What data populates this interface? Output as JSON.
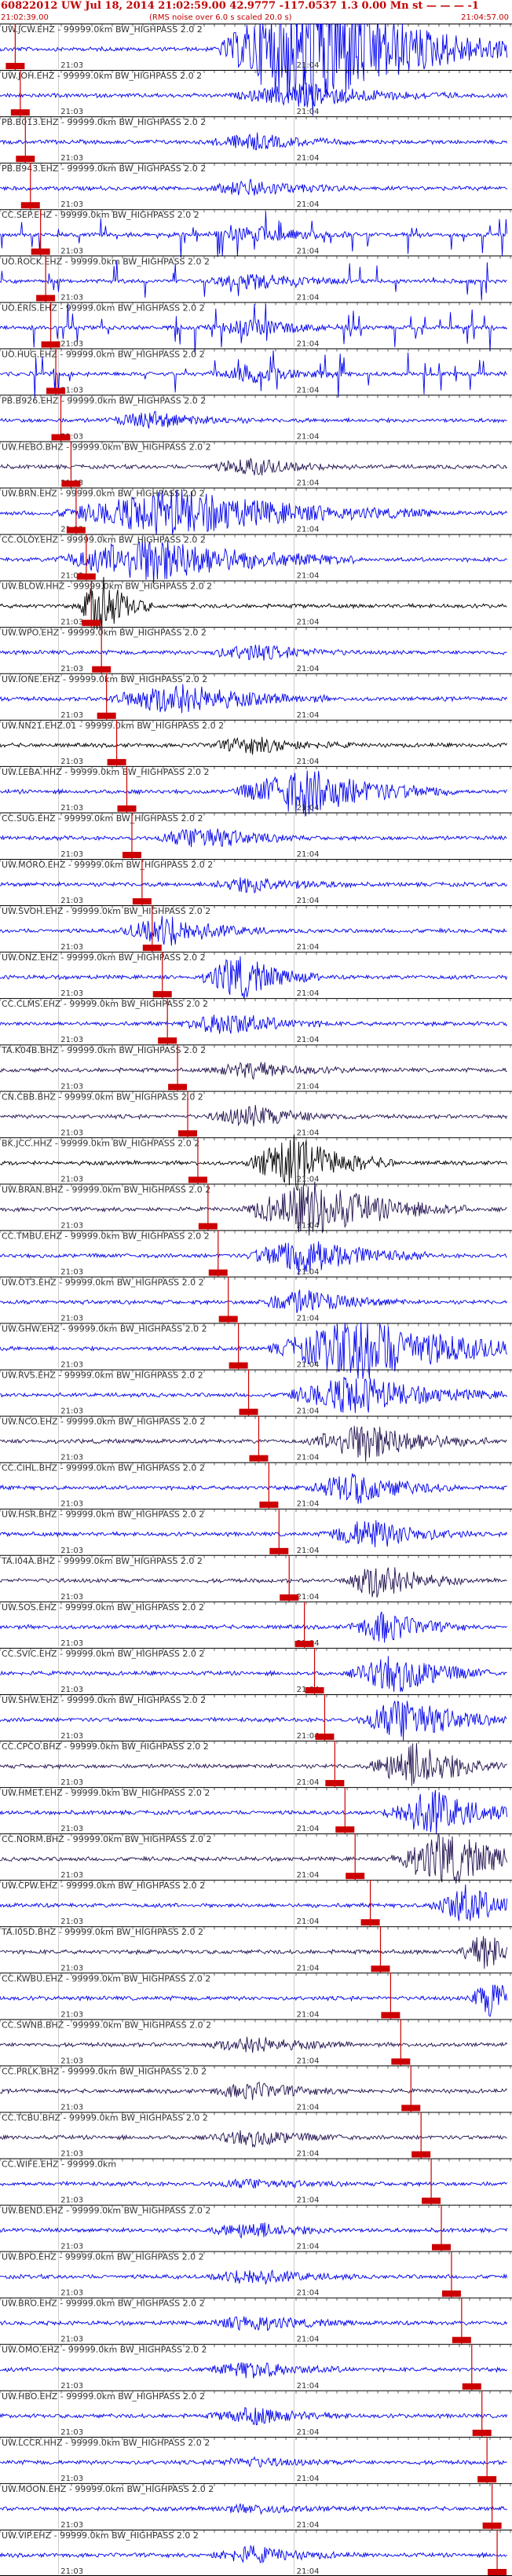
{
  "header": {
    "title": "60822012 UW Jul 18, 2014 21:02:59.00   42.9777 -117.0537  1.3 0.00 Mn st — — — -1",
    "left_time": "21:02:39.00",
    "note": "(RMS noise over 6.0 s scaled 20.0 s)",
    "right_time": "21:04:57.00"
  },
  "colors": {
    "trace_blue": "#0000ee",
    "trace_dark": "#22114f",
    "trace_black": "#000000",
    "pick": "#cc0000",
    "header": "#c00000"
  },
  "chart_data": {
    "type": "line",
    "title": "60822012 UW Jul 18, 2014 21:02:59.00   42.9777 -117.0537  1.3 0.00 Mn st — — — -1",
    "xlabel": "",
    "ylabel": "",
    "time_range": [
      "21:02:39.00",
      "21:04:57.00"
    ],
    "tick_labels": [
      "21:03",
      "21:04"
    ],
    "stations": [
      {
        "label": "UW.JCW.EHZ - 99999.0km BW_HIGHPASS  2.0  2",
        "color": "#0000ee",
        "burst": [
          0.62,
          0.2,
          9
        ],
        "pick": 0.03
      },
      {
        "label": "UW.JOH.EHZ - 99999.0km BW_HIGHPASS  2.0  2",
        "color": "#0000ee",
        "burst": [
          0.6,
          0.15,
          1.5
        ],
        "pick": 0.04
      },
      {
        "label": "PB.B013.EHZ - 99999.0km BW_HIGHPASS  2.0  2",
        "color": "#0000ee",
        "burst": [
          0.5,
          0.1,
          1
        ],
        "pick": 0.05
      },
      {
        "label": "PB.B943.EHZ - 99999.0km BW_HIGHPASS  2.0  2",
        "color": "#0000ee",
        "burst": [
          0.5,
          0.1,
          1
        ],
        "pick": 0.06
      },
      {
        "label": "CC.SEP.EHZ - 99999.0km BW_HIGHPASS  2.0  2",
        "color": "#0000ee",
        "spikes": true,
        "pick": 0.08
      },
      {
        "label": "UO.ROCK.EHZ - 99999.0km BW_HIGHPASS  2.0  2",
        "color": "#0000ee",
        "spikes": true,
        "pick": 0.09
      },
      {
        "label": "UO.ERIS.EHZ - 99999.0km BW_HIGHPASS  2.0  2",
        "color": "#0000ee",
        "spikes": true,
        "pick": 0.1
      },
      {
        "label": "UO.HUG.EHZ - 99999.0km BW_HIGHPASS  2.0  2",
        "color": "#0000ee",
        "spikes": true,
        "pick": 0.11
      },
      {
        "label": "PB.B926.EHZ - 99999.0km BW_HIGHPASS  2.0  2",
        "color": "#0000ee",
        "burst": [
          0.3,
          0.1,
          1
        ],
        "pick": 0.12
      },
      {
        "label": "UW.HEBO.BHZ - 99999.0km BW_HIGHPASS  2.0  2",
        "color": "#22114f",
        "burst": [
          0.5,
          0.1,
          1
        ],
        "pick": 0.14
      },
      {
        "label": "UW.BRN.EHZ - 99999.0km BW_HIGHPASS  2.0  2",
        "color": "#0000ee",
        "burst": [
          0.35,
          0.25,
          3
        ],
        "pick": 0.15
      },
      {
        "label": "CC.OLOY.EHZ - 99999.0km BW_HIGHPASS  2.0  2",
        "color": "#0000ee",
        "burst": [
          0.3,
          0.2,
          3
        ],
        "pick": 0.17
      },
      {
        "label": "UW.BLOW.HHZ - 99999.0km BW_HIGHPASS  2.0  2",
        "color": "#000000",
        "burst": [
          0.2,
          0.05,
          4
        ],
        "pick": 0.18
      },
      {
        "label": "UW.WPO.EHZ - 99999.0km BW_HIGHPASS  2.0  2",
        "color": "#0000ee",
        "burst": [
          0.5,
          0.1,
          1
        ],
        "pick": 0.2
      },
      {
        "label": "UW.IONE.EHZ - 99999.0km BW_HIGHPASS  2.0  2",
        "color": "#0000ee",
        "burst": [
          0.35,
          0.15,
          2
        ],
        "pick": 0.21
      },
      {
        "label": "UW.NN21.EHZ.01 - 99999.0km BW_HIGHPASS  2.0  2",
        "color": "#000000",
        "burst": [
          0.5,
          0.1,
          1
        ],
        "pick": 0.23
      },
      {
        "label": "UW.LEBA.HHZ - 99999.0km BW_HIGHPASS  2.0  2",
        "color": "#0000ee",
        "burst": [
          0.6,
          0.15,
          3
        ],
        "pick": 0.25
      },
      {
        "label": "CC.SUG.EHZ - 99999.0km BW_HIGHPASS  2.0  2",
        "color": "#0000ee",
        "burst": [
          0.4,
          0.1,
          1.5
        ],
        "pick": 0.26
      },
      {
        "label": "UW.MORO.EHZ - 99999.0km BW_HIGHPASS  2.0  2",
        "color": "#0000ee",
        "burst": [
          0.5,
          0.1,
          1
        ],
        "pick": 0.28
      },
      {
        "label": "UW.SVOH.EHZ - 99999.0km BW_HIGHPASS  2.0  2",
        "color": "#0000ee",
        "burst": [
          0.33,
          0.1,
          2
        ],
        "pick": 0.3
      },
      {
        "label": "UW.ONZ.EHZ - 99999.0km BW_HIGHPASS  2.0  2",
        "color": "#0000ee",
        "burst": [
          0.47,
          0.08,
          3
        ],
        "pick": 0.32
      },
      {
        "label": "CC.CLMS.EHZ - 99999.0km BW_HIGHPASS  2.0  2",
        "color": "#0000ee",
        "burst": [
          0.45,
          0.1,
          1.5
        ],
        "pick": 0.33
      },
      {
        "label": "TA.K04B.BHZ - 99999.0km BW_HIGHPASS  2.0  2",
        "color": "#22114f",
        "burst": [
          0.5,
          0.1,
          1
        ],
        "pick": 0.35
      },
      {
        "label": "CN.CBB.BHZ - 99999.0km BW_HIGHPASS  2.0  2",
        "color": "#22114f",
        "burst": [
          0.5,
          0.1,
          1.3
        ],
        "pick": 0.37
      },
      {
        "label": "BK.JCC.HHZ - 99999.0km BW_HIGHPASS  2.0  2",
        "color": "#000000",
        "burst": [
          0.58,
          0.1,
          3.5
        ],
        "pick": 0.39
      },
      {
        "label": "UW.BRAN.BHZ - 99999.0km BW_HIGHPASS  2.0  2",
        "color": "#22114f",
        "burst": [
          0.62,
          0.15,
          3.5
        ],
        "pick": 0.41
      },
      {
        "label": "CC.TMBU.EHZ - 99999.0km BW_HIGHPASS  2.0  2",
        "color": "#0000ee",
        "burst": [
          0.6,
          0.12,
          2.5
        ],
        "pick": 0.43
      },
      {
        "label": "UW.OT3.EHZ - 99999.0km BW_HIGHPASS  2.0  2",
        "color": "#0000ee",
        "burst": [
          0.6,
          0.1,
          1.5
        ],
        "pick": 0.45
      },
      {
        "label": "UW.GHW.EHZ - 99999.0km BW_HIGHPASS  2.0  2",
        "color": "#0000ee",
        "burst": [
          0.72,
          0.2,
          4
        ],
        "pick": 0.47
      },
      {
        "label": "UW.RVS.EHZ - 99999.0km BW_HIGHPASS  2.0  2",
        "color": "#0000ee",
        "burst": [
          0.7,
          0.15,
          2.5
        ],
        "pick": 0.49
      },
      {
        "label": "UW.NCO.EHZ - 99999.0km BW_HIGHPASS  2.0  2",
        "color": "#22114f",
        "burst": [
          0.72,
          0.12,
          2.5
        ],
        "pick": 0.51
      },
      {
        "label": "CC.CIHL.BHZ - 99999.0km BW_HIGHPASS  2.0  2",
        "color": "#0000ee",
        "burst": [
          0.7,
          0.1,
          2
        ],
        "pick": 0.53
      },
      {
        "label": "UW.HSR.BHZ - 99999.0km BW_HIGHPASS  2.0  2",
        "color": "#0000ee",
        "burst": [
          0.73,
          0.1,
          2
        ],
        "pick": 0.55
      },
      {
        "label": "TA.I04A.BHZ - 99999.0km BW_HIGHPASS  2.0  2",
        "color": "#22114f",
        "burst": [
          0.75,
          0.08,
          2.5
        ],
        "pick": 0.57
      },
      {
        "label": "UW.SOS.EHZ - 99999.0km BW_HIGHPASS  2.0  2",
        "color": "#0000ee",
        "burst": [
          0.76,
          0.08,
          2
        ],
        "pick": 0.6
      },
      {
        "label": "CC.SVIC.EHZ - 99999.0km BW_HIGHPASS  2.0  2",
        "color": "#0000ee",
        "burst": [
          0.78,
          0.1,
          2.5
        ],
        "pick": 0.62
      },
      {
        "label": "UW.SHW.EHZ - 99999.0km BW_HIGHPASS  2.0  2",
        "color": "#0000ee",
        "burst": [
          0.8,
          0.1,
          3
        ],
        "pick": 0.64
      },
      {
        "label": "CC.CPCO.BHZ - 99999.0km BW_HIGHPASS  2.0  2",
        "color": "#22114f",
        "burst": [
          0.82,
          0.1,
          3
        ],
        "pick": 0.66
      },
      {
        "label": "UW.HMET.EHZ - 99999.0km BW_HIGHPASS  2.0  2",
        "color": "#0000ee",
        "burst": [
          0.85,
          0.1,
          3
        ],
        "pick": 0.68
      },
      {
        "label": "CC.NORM.BHZ - 99999.0km BW_HIGHPASS  2.0  2",
        "color": "#22114f",
        "burst": [
          0.88,
          0.12,
          3.5
        ],
        "pick": 0.7
      },
      {
        "label": "UW.CPW.EHZ - 99999.0km BW_HIGHPASS  2.0  2",
        "color": "#0000ee",
        "burst": [
          0.92,
          0.08,
          2.5
        ],
        "pick": 0.73
      },
      {
        "label": "TA.I05D.BHZ - 99999.0km BW_HIGHPASS  2.0  2",
        "color": "#22114f",
        "burst": [
          0.96,
          0.06,
          2.5
        ],
        "pick": 0.75
      },
      {
        "label": "CC.KWBU.EHZ - 99999.0km BW_HIGHPASS  2.0  2",
        "color": "#0000ee",
        "burst": [
          0.97,
          0.05,
          2.5
        ],
        "pick": 0.77
      },
      {
        "label": "CC.SWNB.BHZ - 99999.0km BW_HIGHPASS  2.0  2",
        "color": "#22114f",
        "burst": [
          0.5,
          0.1,
          1
        ],
        "pick": 0.79
      },
      {
        "label": "CC.PRLK.BHZ - 99999.0km BW_HIGHPASS  2.0  2",
        "color": "#22114f",
        "burst": [
          0.5,
          0.1,
          1
        ],
        "pick": 0.81
      },
      {
        "label": "CC.TCBU.BHZ - 99999.0km BW_HIGHPASS  2.0  2",
        "color": "#22114f",
        "burst": [
          0.5,
          0.1,
          1
        ],
        "pick": 0.83
      },
      {
        "label": "CC.WIFE.EHZ - 99999.0km",
        "color": "#0000ee",
        "burst": [
          0.5,
          0.1,
          0.5
        ],
        "pick": 0.85
      },
      {
        "label": "UW.BEND.EHZ - 99999.0km BW_HIGHPASS  2.0  2",
        "color": "#0000ee",
        "burst": [
          0.5,
          0.1,
          1
        ],
        "pick": 0.87
      },
      {
        "label": "UW.BPO.EHZ - 99999.0km BW_HIGHPASS  2.0  2",
        "color": "#0000ee",
        "burst": [
          0.5,
          0.1,
          1
        ],
        "pick": 0.89
      },
      {
        "label": "UW.BRO.EHZ - 99999.0km BW_HIGHPASS  2.0  2",
        "color": "#0000ee",
        "burst": [
          0.5,
          0.1,
          1
        ],
        "pick": 0.91
      },
      {
        "label": "UW.OMO.EHZ - 99999.0km BW_HIGHPASS  2.0  2",
        "color": "#0000ee",
        "burst": [
          0.5,
          0.1,
          1
        ],
        "pick": 0.93
      },
      {
        "label": "UW.HBO.EHZ - 99999.0km BW_HIGHPASS  2.0  2",
        "color": "#0000ee",
        "burst": [
          0.5,
          0.1,
          1
        ],
        "pick": 0.95
      },
      {
        "label": "UW.LCCR.HHZ - 99999.0km BW_HIGHPASS  2.0  2",
        "color": "#0000ee",
        "burst": [
          0.5,
          0.1,
          0.5
        ],
        "pick": 0.96
      },
      {
        "label": "UW.MOON.EHZ - 99999.0km BW_HIGHPASS  2.0  2",
        "color": "#0000ee",
        "burst": [
          0.5,
          0.1,
          0.5
        ],
        "pick": 0.97
      },
      {
        "label": "UW.VIP.EHZ - 99999.0km BW_HIGHPASS  2.0  2",
        "color": "#0000ee",
        "burst": [
          0.5,
          0.1,
          1
        ],
        "pick": 0.98
      }
    ]
  }
}
